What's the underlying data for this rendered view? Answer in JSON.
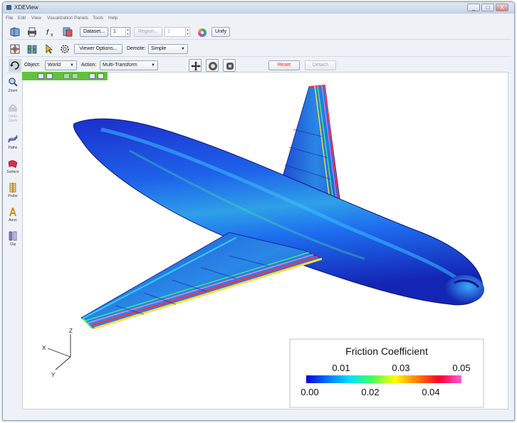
{
  "window": {
    "title": "XDEView",
    "controls": [
      "_",
      "□",
      "X"
    ]
  },
  "menu": [
    "File",
    "Edit",
    "View",
    "Visualization Panels",
    "Tools",
    "Help"
  ],
  "toolbar1": {
    "dataset_button": "Dataset...",
    "dataset_value": "1",
    "region_button": "Region...",
    "region_value": "1",
    "unify_button": "Unify"
  },
  "toolbar2": {
    "viewer_options_button": "Viewer Options...",
    "demote_label": "Demote:",
    "demote_value": "Simple"
  },
  "toolbar3": {
    "object_label": "Object:",
    "object_value": "World",
    "action_label": "Action:",
    "action_value": "Multi-Transform",
    "reset_button": "Reset",
    "detach_button": "Detach"
  },
  "sidebar": [
    {
      "label": "Zoom",
      "icon": "magnifier-icon",
      "enabled": true
    },
    {
      "label": "Undo Zoom",
      "icon": "undo-zoom-icon",
      "enabled": false
    },
    {
      "label": "Paths",
      "icon": "paths-icon",
      "enabled": true
    },
    {
      "label": "Surface",
      "icon": "surface-icon",
      "enabled": true
    },
    {
      "label": "Probe",
      "icon": "probe-icon",
      "enabled": true
    },
    {
      "label": "Anno",
      "icon": "annotation-icon",
      "enabled": true
    },
    {
      "label": "Clip",
      "icon": "clip-icon",
      "enabled": true
    }
  ],
  "axes": {
    "x": "X",
    "y": "Y",
    "z": "Z"
  },
  "legend": {
    "title": "Friction Coefficient",
    "top_ticks": [
      "0.01",
      "0.03",
      "0.05"
    ],
    "bottom_ticks": [
      "0.00",
      "0.02",
      "0.04"
    ],
    "range": [
      0.0,
      0.05
    ]
  },
  "colors": {
    "reset_text": "#e02020",
    "frame_toolbar": "#62c13d",
    "colormap": [
      "#0a00e0",
      "#0078ff",
      "#00e0ff",
      "#40ff60",
      "#ffff00",
      "#ff8000",
      "#ff0030",
      "#ff60e0"
    ]
  }
}
